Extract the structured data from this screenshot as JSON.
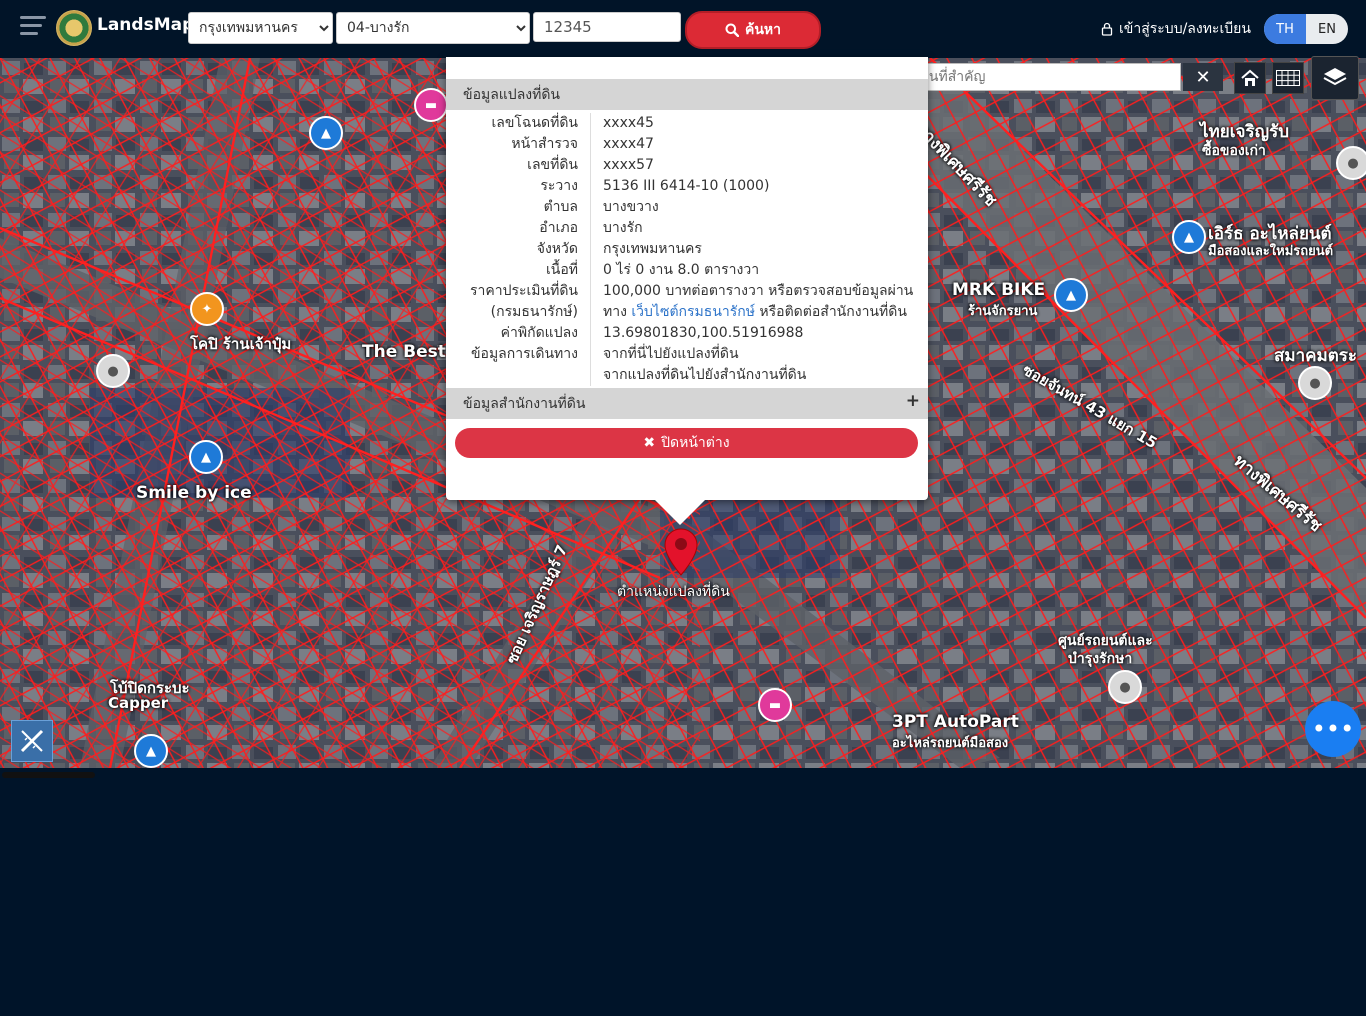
{
  "header": {
    "logo_text": "LandsMaps",
    "province_select": "กรุงเทพมหานคร",
    "district_select": "04-บางรัก",
    "parcel_number_value": "12345",
    "search_label": "ค้นหา",
    "login_label": "เข้าสู่ระบบ/ลงทะเบียน",
    "lang_th": "TH",
    "lang_en": "EN"
  },
  "map": {
    "place_search_placeholder": "ค้นหาสถานที่สำคัญ",
    "clear_label": "✕",
    "labels": {
      "road_phiset_1": "ทางพิเศษศรีรัช",
      "road_phiset_2": "ทางพิเศษศรีรัช",
      "mrk_bike": "MRK BIKE",
      "mrk_bike_th": "ร้านจักรยาน",
      "smile_by_ice": "Smile by ice",
      "the_best": "The Best",
      "thai_charoen": "ไทยเจริญรับ",
      "thai_charoen2": "ซื้อของเก่า",
      "eiri_auto": "เอิร์ธ อะไหล่ยนต์",
      "eiri_auto2": "มือสองและใหม่รถยนต์",
      "samakom": "สมาคมตระ",
      "auto_part": "3PT AutoPart",
      "auto_part2": "อะไหล่รถยนต์มือสอง",
      "soi_charoen": "ซอย เจริญราษฎร์ 7",
      "soi_phiset": "ซอยจันทน์ 43 แยก 15",
      "parcel_marker": "ตำแหน่งแปลงที่ดิน",
      "car_service": "ศูนย์รถยนต์และ",
      "car_service2": "บำรุงรักษา",
      "kopi": "โคปิ ร้านเจ้าปุ๋ม",
      "auto_cap": "โบ้ปิดกระบะ",
      "caps": "Capper"
    },
    "marker_label": "ตำแหน่งแปลงที่ดิน"
  },
  "popup": {
    "section1_title": "ข้อมูลแปลงที่ดิน",
    "rows": [
      {
        "k": "เลขโฉนดที่ดิน",
        "v": "xxxx45"
      },
      {
        "k": "หน้าสำรวจ",
        "v": "xxxx47"
      },
      {
        "k": "เลขที่ดิน",
        "v": "xxxx57"
      },
      {
        "k": "ระวาง",
        "v": "5136 III 6414-10 (1000)"
      },
      {
        "k": "ตำบล",
        "v": "บางขวาง"
      },
      {
        "k": "อำเภอ",
        "v": "บางรัก"
      },
      {
        "k": "จังหวัด",
        "v": "กรุงเทพมหานคร"
      },
      {
        "k": "เนื้อที่",
        "v": "0 ไร่ 0 งาน 8.0 ตารางวา"
      }
    ],
    "price_key1": "ราคาประเมินที่ดิน",
    "price_key2": "(กรมธนารักษ์)",
    "price_v1": "100,000 บาทต่อตารางวา หรือตรวจสอบข้อมูลผ่าน",
    "price_v2_pre": "ทาง ",
    "price_v2_link": "เว็บไซต์กรมธนารักษ์",
    "price_v2_post": " หรือติดต่อสำนักงานที่ดิน",
    "coord_key": "ค่าพิกัดแปลง",
    "coord_value": "13.69801830,100.51916988",
    "route_key": "ข้อมูลการเดินทาง",
    "route_link1": "จากที่นี่ไปยังแปลงที่ดิน",
    "route_link2": "จากแปลงที่ดินไปยังสำนักงานที่ดิน",
    "section2_title": "ข้อมูลสำนักงานที่ดิน",
    "section2_plus": "+",
    "close_label": "ปิดหน้าต่าง"
  },
  "colors": {
    "accent_red": "#dc3545",
    "primary_blue": "#1a7ef2",
    "topbar": "#011428"
  }
}
